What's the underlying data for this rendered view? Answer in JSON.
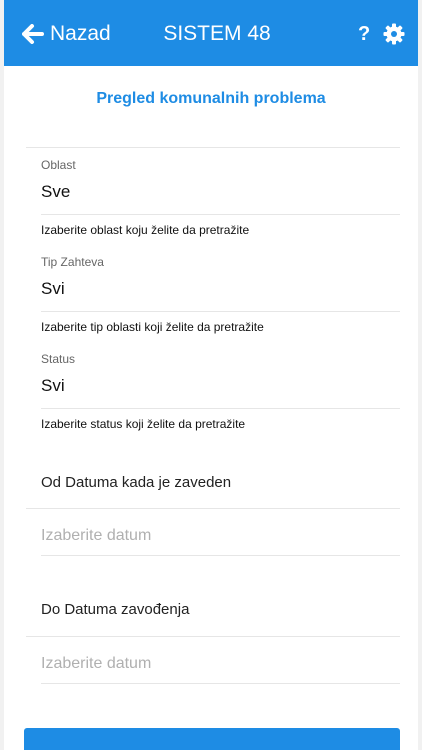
{
  "header": {
    "back_label": "Nazad",
    "title": "SISTEM 48",
    "help_symbol": "?",
    "icons": {
      "back": "arrow-left-icon",
      "settings": "gear-icon"
    },
    "color": "#1e8ce4"
  },
  "page": {
    "title": "Pregled komunalnih problema"
  },
  "fields": {
    "oblast": {
      "label": "Oblast",
      "value": "Sve",
      "hint": "Izaberite oblast koju želite da pretražite"
    },
    "tip": {
      "label": "Tip Zahteva",
      "value": "Svi",
      "hint": "Izaberite tip oblasti koji želite da pretražite"
    },
    "status": {
      "label": "Status",
      "value": "Svi",
      "hint": "Izaberite status koji želite da pretražite"
    }
  },
  "dates": {
    "from": {
      "label": "Od Datuma kada je zaveden",
      "placeholder": "Izaberite datum"
    },
    "to": {
      "label": "Do Datuma zavođenja",
      "placeholder": "Izaberite datum"
    }
  }
}
